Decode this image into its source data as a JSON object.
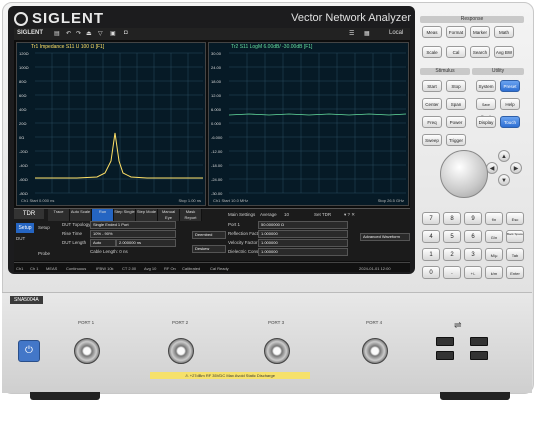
{
  "brand": "SIGLENT",
  "model_title": "Vector Network Analyzer",
  "toolbar": {
    "logo": "SIGLENT",
    "icons": [
      "file-icon",
      "undo-icon",
      "redo-icon",
      "trigger-icon",
      "marker-icon",
      "save-icon",
      "camera-icon"
    ],
    "status": "Local"
  },
  "trace1": {
    "title": "Tr1 Impedance S11 U 100 Ω [F1]",
    "y_labels": [
      "120Ω",
      "100Ω",
      "80Ω",
      "60Ω",
      "40Ω",
      "20Ω",
      "0Ω",
      "-20Ω",
      "-40Ω",
      "-60Ω",
      "-80Ω"
    ],
    "footer_left": "Ch1 Start 0.000 ns",
    "footer_right": "Stop 1.00 ns"
  },
  "trace2": {
    "title": "Tr2 S11 LogM 6.00dB/ -30.00dB [F1]",
    "y_labels": [
      "30.00",
      "24.00",
      "18.00",
      "12.00",
      "6.000",
      "0.000",
      "-6.000",
      "-12.00",
      "-18.00",
      "-24.00",
      "-30.00"
    ],
    "footer_left": "Ch1 Start 10.0 MHz",
    "footer_right": "Stop 26.5 GHz"
  },
  "tdr_panel": {
    "tab": "TDR",
    "softkeys": [
      "Trace",
      "Auto Scale",
      "Run",
      "Step Single",
      "Step Mode",
      "Manual Eye",
      "Mask Report"
    ],
    "active_softkey": "Run",
    "setup_tab": "Setup",
    "left_items": [
      "DUT",
      "Setup",
      "Probe"
    ],
    "dut_topology": "Single Ended 1 Port",
    "rise_time": "Rise Time",
    "rise_value": "10% - 90%",
    "dut_length": "DUT Length",
    "dut_length_mode": "Auto",
    "dut_length_value": "2.000000 ns",
    "cable_length": "Cable Length: 0 ns",
    "deembed_btn": "Deembed",
    "deskew": "Deskew",
    "main_settings": "Main Settings",
    "average": "Average",
    "avg_value": "10",
    "set_ref": "Set TDR",
    "params": [
      {
        "label": "Port 1",
        "value": "50.000000 Ω"
      },
      {
        "label": "Reflection Factor",
        "value": "1.000000"
      },
      {
        "label": "Velocity Factor",
        "value": "1.000000"
      },
      {
        "label": "Dielectric Const",
        "value": "1.000000"
      }
    ],
    "advanced": "Advanced Waveform"
  },
  "statusbar": {
    "items": [
      "Ch1",
      "Ch 1",
      "MEAS",
      "Continuous",
      "IFBW 10k",
      "CT 2.00",
      "Avg 10",
      "RF On",
      "Calibrated",
      "Cal Ready"
    ],
    "datetime": "2024-01-01 12:00"
  },
  "keypad": {
    "response": "Response",
    "response_keys": [
      "Meas",
      "Format",
      "Marker",
      "Math",
      "Scale",
      "Cal",
      "Search",
      "Avg BW"
    ],
    "stimulus": "Stimulus",
    "utility": "Utility",
    "stim_keys": [
      "Start",
      "Stop",
      "Center",
      "Span",
      "Freq",
      "Power",
      "Sweep",
      "Trigger"
    ],
    "util_keys": [
      "System",
      "Preset",
      "Save Recall",
      "Help",
      "Display",
      "Touch"
    ],
    "num_keys": [
      "7",
      "8",
      "9",
      "Esc",
      "4",
      "5",
      "6",
      "Back Space",
      "1",
      "2",
      "3",
      "Tab",
      "0",
      ".",
      "+/-",
      "Enter"
    ],
    "num_extra": [
      "f/n",
      "G/n",
      "M/μ",
      "k/m"
    ]
  },
  "bottom": {
    "model_label": "SNA5004A",
    "ports": [
      "PORT 1",
      "PORT 2",
      "PORT 3",
      "PORT 4"
    ],
    "warning": "⚠ +27dBm RF 35VDC Max  Avoid Static Discharge"
  }
}
